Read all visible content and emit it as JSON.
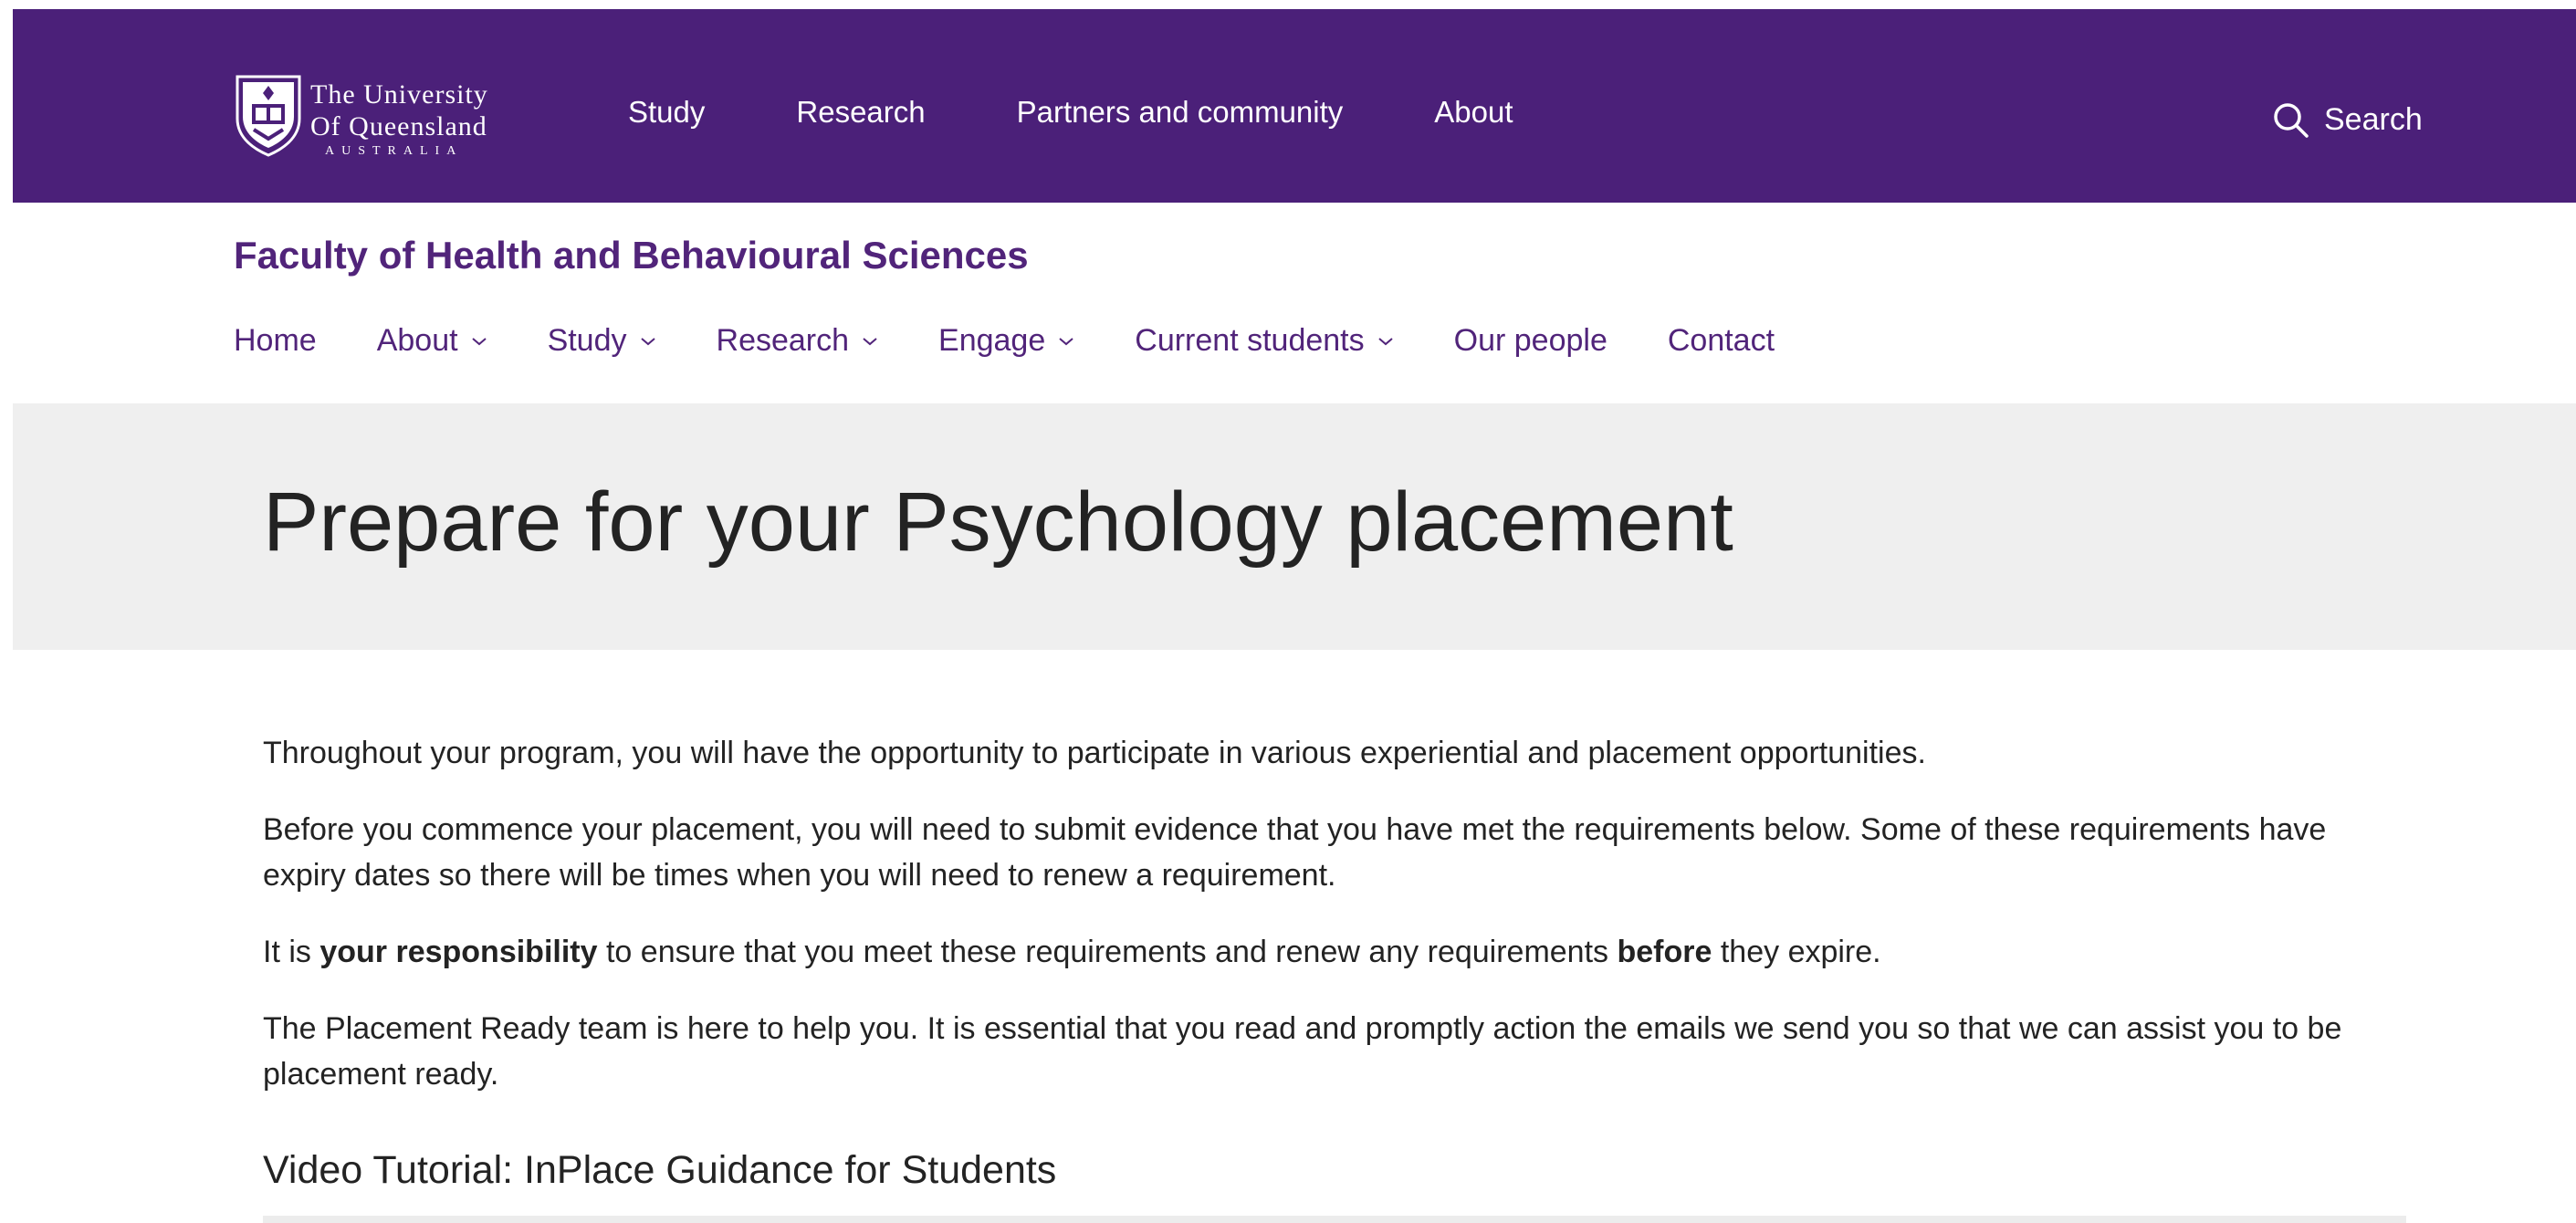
{
  "header": {
    "logo": {
      "line1": "The University",
      "line2": "Of Queensland",
      "line3": "AUSTRALIA"
    },
    "nav": [
      "Study",
      "Research",
      "Partners and community",
      "About"
    ],
    "search_label": "Search",
    "icons": {
      "search": "search-icon",
      "crest": "uq-crest-icon"
    }
  },
  "faculty": {
    "title": "Faculty of Health and Behavioural Sciences",
    "nav": [
      {
        "label": "Home",
        "dropdown": false
      },
      {
        "label": "About",
        "dropdown": true
      },
      {
        "label": "Study",
        "dropdown": true
      },
      {
        "label": "Research",
        "dropdown": true
      },
      {
        "label": "Engage",
        "dropdown": true
      },
      {
        "label": "Current students",
        "dropdown": true
      },
      {
        "label": "Our people",
        "dropdown": false
      },
      {
        "label": "Contact",
        "dropdown": false
      }
    ]
  },
  "page": {
    "title": "Prepare for your Psychology placement",
    "p1": "Throughout your program, you will have the opportunity to participate in various experiential and placement opportunities.",
    "p2": "Before you commence your placement, you will need to submit evidence that you have met the requirements below. Some of these requirements have expiry dates so there will be times when you will need to renew a requirement.",
    "p3": {
      "a": "It is ",
      "b": "your responsibility",
      "c": " to ensure that you meet these requirements and renew any requirements ",
      "d": "before",
      "e": " they expire."
    },
    "p4": "The Placement Ready team is here to help you. It is essential that you read and promptly action the emails we send you so that we can assist you to be placement ready.",
    "subheading": "Video Tutorial: InPlace Guidance for Students"
  },
  "colors": {
    "brand_purple": "#4b2079",
    "link_purple": "#51247a",
    "hero_bg": "#efefef",
    "text": "#232323"
  }
}
